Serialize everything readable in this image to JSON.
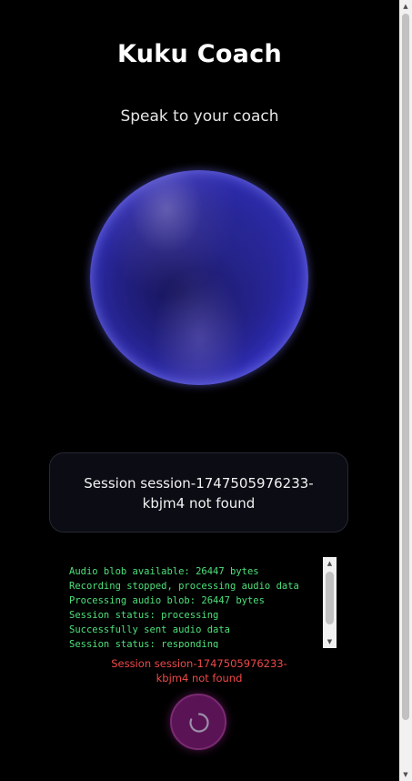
{
  "app": {
    "title": "Kuku Coach",
    "subtitle": "Speak to your coach"
  },
  "status_card": {
    "message": "Session session-1747505976233-kbjm4 not found"
  },
  "log": {
    "lines": [
      "Audio blob available: 26447 bytes",
      "Recording stopped, processing audio data",
      "Processing audio blob: 26447 bytes",
      "Session status: processing",
      "Successfully sent audio data",
      "Session status: responding"
    ]
  },
  "error": {
    "message": "Session session-1747505976233-kbjm4 not found"
  },
  "icons": {
    "orb": "voice-orb",
    "record_button": "spinner-icon",
    "scroll_up": "chevron-up-icon",
    "scroll_down": "chevron-down-icon"
  },
  "colors": {
    "background": "#000000",
    "log_text": "#4ee07a",
    "error_text": "#f04848",
    "orb_accent": "#3a38c8",
    "record_button": "#5a1456"
  }
}
